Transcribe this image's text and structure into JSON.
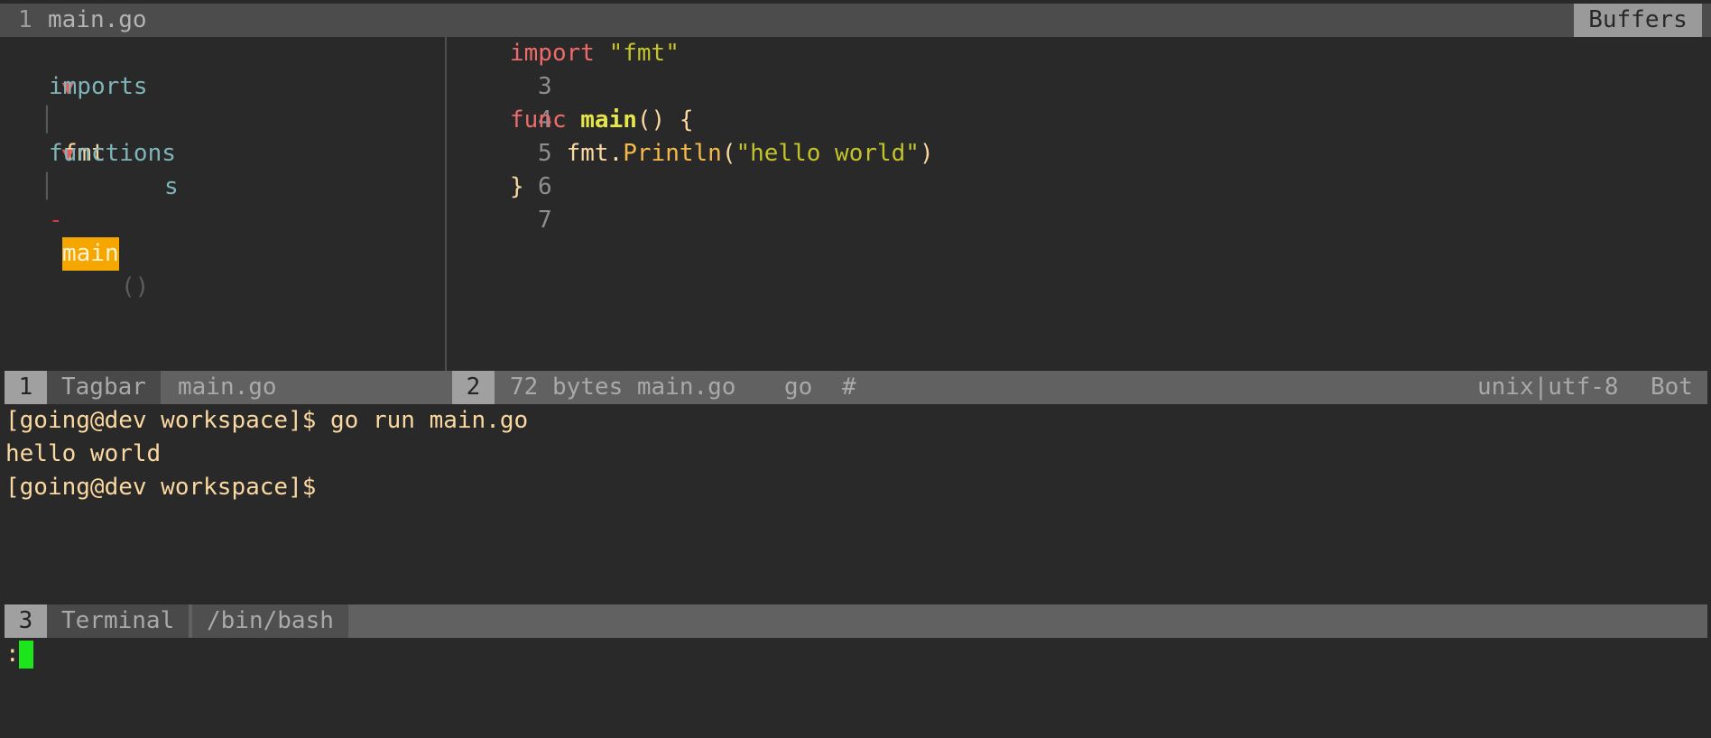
{
  "tabline": {
    "tab_number": "1",
    "tab_file": "main.go",
    "buffers_label": "Buffers"
  },
  "tagbar": {
    "groups": [
      {
        "fold_icon": "▼",
        "kind": "imports",
        "items": [
          {
            "name": "fmt",
            "type": "s"
          }
        ]
      },
      {
        "fold_icon": "▼",
        "kind": "functions",
        "items": [
          {
            "prefix": "-",
            "name": "main",
            "signature": "()"
          }
        ]
      }
    ]
  },
  "editor": {
    "lines": [
      {
        "number": "3",
        "tokens": [
          "import",
          " ",
          "\"fmt\""
        ]
      },
      {
        "number": "4",
        "tokens": []
      },
      {
        "number": "5",
        "tokens": [
          "func",
          " ",
          "main",
          "() {"
        ]
      },
      {
        "number": "6",
        "tokens": [
          "    fmt.",
          "Println",
          "(",
          "\"hello world\"",
          ")"
        ]
      },
      {
        "number": "7",
        "tokens": [
          "}"
        ]
      }
    ]
  },
  "status_top": {
    "left": {
      "window_number": "1",
      "mode": "Tagbar",
      "file": "main.go"
    },
    "right": {
      "window_number": "2",
      "info": "72 bytes main.go",
      "filetype": "go",
      "modified": "#",
      "encoding": "unix|utf-8",
      "position": "Bot"
    }
  },
  "terminal": {
    "lines": [
      "[going@dev workspace]$ go run main.go",
      "hello world",
      "[going@dev workspace]$"
    ]
  },
  "status_bottom": {
    "window_number": "3",
    "mode": "Terminal",
    "shell": "/bin/bash"
  },
  "cmdline": {
    "prompt": ":"
  },
  "colors": {
    "background": "#292929",
    "keyword": "#ef6b6b",
    "string": "#c3c32a",
    "selected_tag": "#f5a700",
    "cursor": "#1ce51c"
  }
}
